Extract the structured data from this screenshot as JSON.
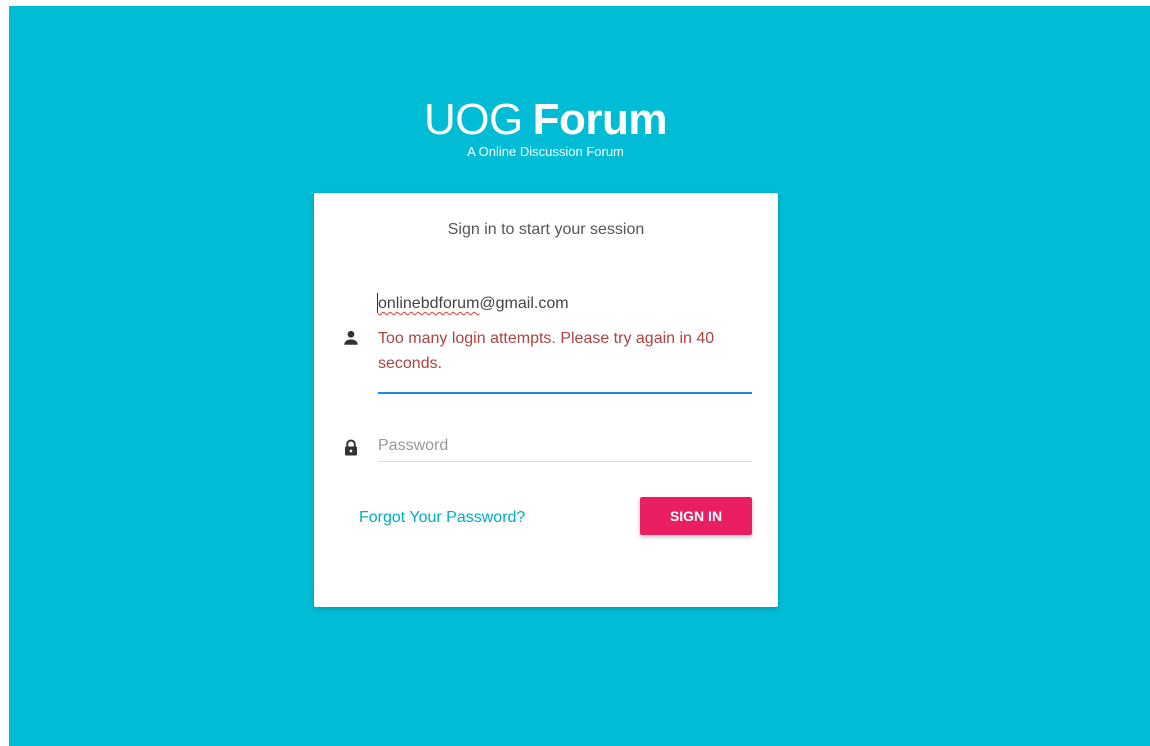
{
  "logo": {
    "title_light": "UOG",
    "title_bold": "Forum",
    "subtitle": "A Online Discussion Forum"
  },
  "login_box": {
    "header": "Sign in to start your session",
    "email": {
      "value_misspelled": "onlinebdforum",
      "value_rest": "@gmail.com",
      "icon": "person-icon",
      "error": "Too many login attempts. Please try again in 40 seconds."
    },
    "password": {
      "placeholder": "Password",
      "icon": "lock-icon"
    },
    "forgot_link": "Forgot Your Password?",
    "signin_label": "SIGN IN"
  },
  "colors": {
    "background": "#00bcd4",
    "accent_button": "#e91e63",
    "error": "#a94442",
    "link": "#00acc1",
    "focus_underline": "#1e88e5"
  }
}
